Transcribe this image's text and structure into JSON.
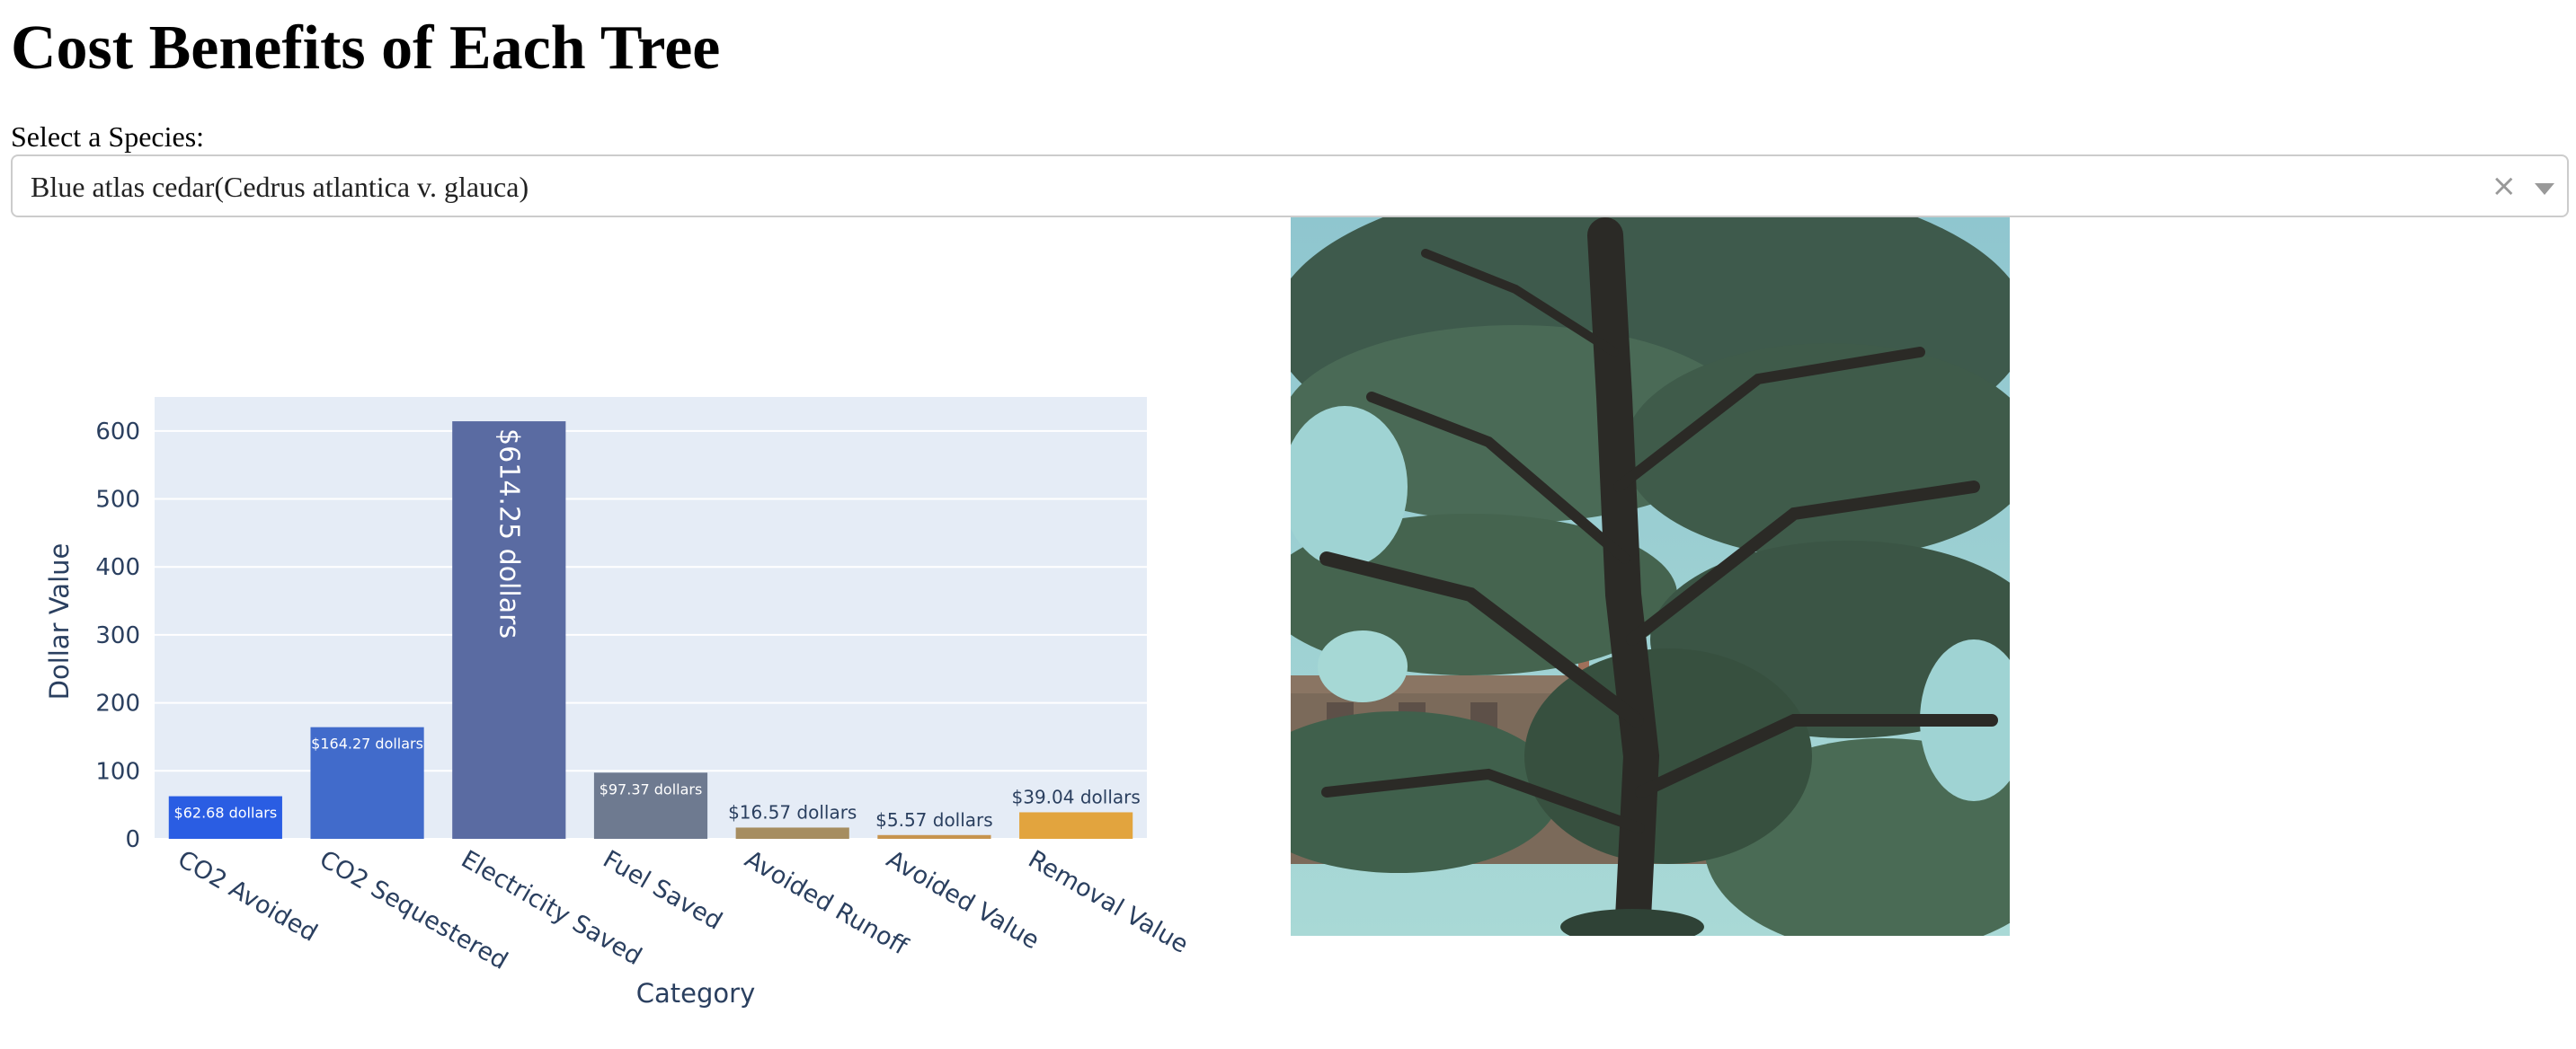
{
  "header": {
    "title": "Cost Benefits of Each Tree"
  },
  "species_select": {
    "label": "Select a Species:",
    "value": "Blue atlas cedar(Cedrus atlantica v. glauca)",
    "clear_icon": "close-icon",
    "dropdown_icon": "chevron-down-icon"
  },
  "colors": {
    "plot_bg": "#e5ecf6",
    "grid": "#ffffff",
    "axis_text": "#2a3f5f"
  },
  "chart_data": {
    "type": "bar",
    "title": "",
    "xlabel": "Category",
    "ylabel": "Dollar Value",
    "ylim": [
      0,
      650
    ],
    "yticks": [
      0,
      100,
      200,
      300,
      400,
      500,
      600
    ],
    "grid": true,
    "categories": [
      "CO2 Avoided",
      "CO2 Sequestered",
      "Electricity Saved",
      "Fuel Saved",
      "Avoided Runoff",
      "Avoided Value",
      "Removal Value"
    ],
    "values": [
      62.68,
      164.27,
      614.25,
      97.37,
      16.57,
      5.57,
      39.04
    ],
    "labels": [
      "$62.68 dollars",
      "$164.27 dollars",
      "$614.25 dollars",
      "$97.37 dollars",
      "$16.57 dollars",
      "$5.57 dollars",
      "$39.04 dollars"
    ],
    "colors": [
      "#2a5de3",
      "#416bcb",
      "#5a6ba2",
      "#6e7a90",
      "#a68d60",
      "#c7944e",
      "#e2a43e"
    ]
  },
  "image": {
    "description": "Blue atlas cedar tree photo",
    "icon": "tree-photo"
  }
}
